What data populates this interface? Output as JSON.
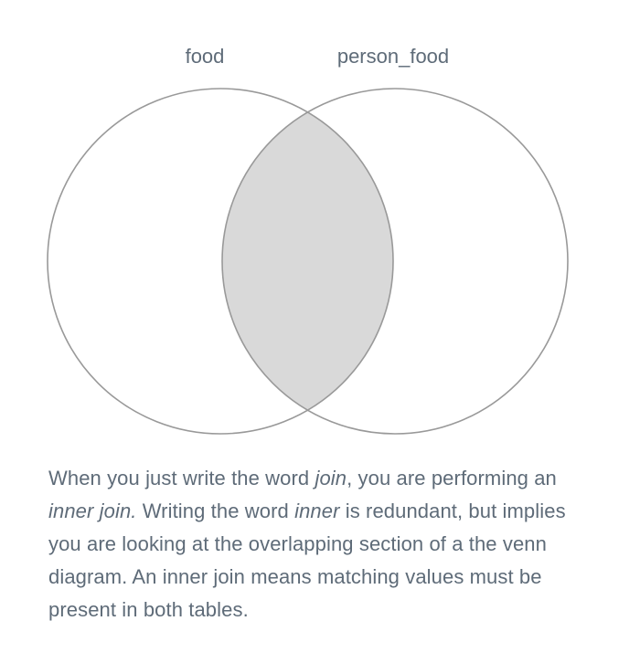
{
  "diagram": {
    "left_set_label": "food",
    "right_set_label": "person_food",
    "highlight_color": "#d9d9d9",
    "outline_color": "#999999"
  },
  "explanation": {
    "part_1": "When you just write the word ",
    "em_1": "join",
    "part_2": ", you are performing an ",
    "em_2": "inner join.",
    "part_3": " Writing the word ",
    "em_3": "inner",
    "part_4": " is redundant, but implies you are looking at the overlapping section of a the venn diagram. An inner join means matching values must be present in both tables."
  }
}
